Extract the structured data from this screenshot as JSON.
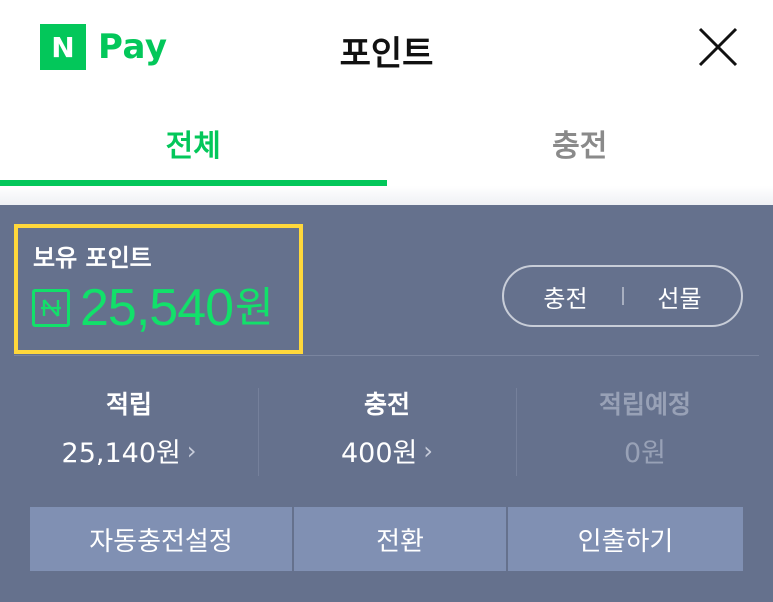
{
  "header": {
    "logo_mark": "N",
    "logo_text": "Pay",
    "title": "포인트"
  },
  "tabs": [
    {
      "label": "전체",
      "active": true
    },
    {
      "label": "충전",
      "active": false
    }
  ],
  "balance": {
    "label": "보유 포인트",
    "amount": "25,540",
    "unit": "원"
  },
  "pill": {
    "charge_label": "충전",
    "gift_label": "선물"
  },
  "stats": [
    {
      "label": "적립",
      "value": "25,140원",
      "chevron": "›"
    },
    {
      "label": "충전",
      "value": "400원",
      "chevron": "›"
    },
    {
      "label": "적립예정",
      "value": "0원"
    }
  ],
  "actions": [
    "자동충전설정",
    "전환",
    "인출하기"
  ],
  "colors": {
    "brand_green": "#03c75a",
    "panel_bg": "#65718d",
    "highlight": "#ffd83b",
    "action_bg": "#8090b3"
  },
  "icons": {
    "close": "close-icon",
    "coin": "n-coin-icon",
    "chevron": "chevron-right-icon"
  }
}
